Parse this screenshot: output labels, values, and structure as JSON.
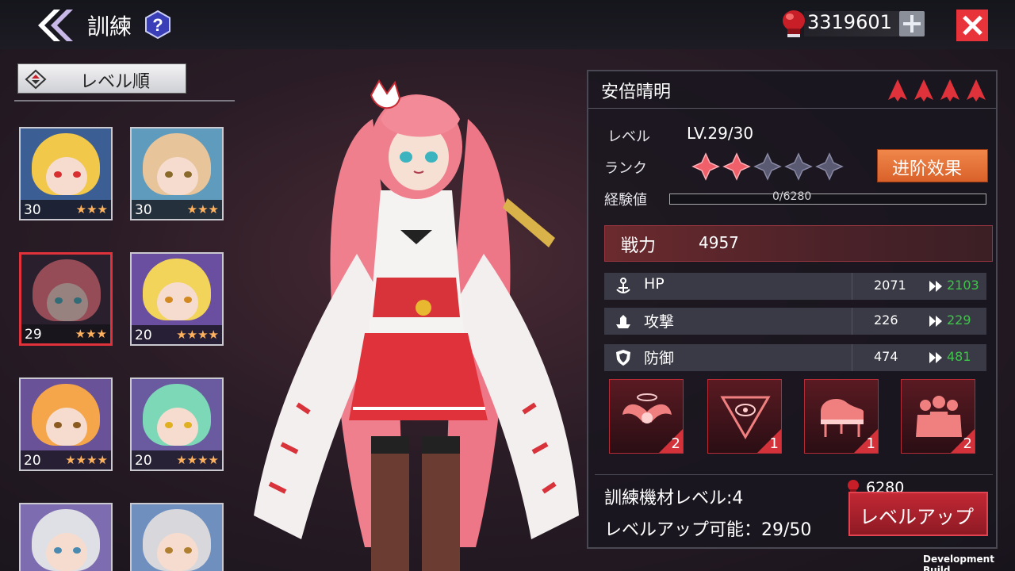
{
  "header": {
    "title": "訓練",
    "help_icon": "question-icon",
    "currency_value": "3319601",
    "currency_icon": "boxing-glove-icon",
    "add_icon": "plus-icon",
    "close_icon": "close-icon",
    "back_icon": "double-chevron-left-icon"
  },
  "sort": {
    "label": "レベル順"
  },
  "roster": [
    {
      "level": "30",
      "stars": "★★★",
      "hair": "#f2c84a",
      "eye": "#d83030",
      "bg": "#3b5f95"
    },
    {
      "level": "30",
      "stars": "★★★",
      "hair": "#e8c49a",
      "eye": "#8a6a2a",
      "bg": "#5f9bbd"
    },
    {
      "level": "29",
      "stars": "★★★",
      "hair": "#f07a86",
      "eye": "#3bb4c0",
      "bg": "#2c2a3a",
      "selected": true
    },
    {
      "level": "20",
      "stars": "★★★★",
      "hair": "#f2d45a",
      "eye": "#d28a20",
      "bg": "#6a4fa0"
    },
    {
      "level": "20",
      "stars": "★★★★",
      "hair": "#f5a64a",
      "eye": "#8a5a20",
      "bg": "#6a5298"
    },
    {
      "level": "20",
      "stars": "★★★★",
      "hair": "#7dd8b8",
      "eye": "#e0b020",
      "bg": "#6a5aa0"
    },
    {
      "level": "",
      "stars": "",
      "hair": "#dfe0e6",
      "eye": "#4a8ab0",
      "bg": "#7d6cb0"
    },
    {
      "level": "",
      "stars": "",
      "hair": "#d8d8dc",
      "eye": "#b08030",
      "bg": "#6f8fbf"
    }
  ],
  "panel": {
    "name": "安倍晴明",
    "level_label": "レベル",
    "level_value": "LV.29/30",
    "rank_label": "ランク",
    "rank_filled": 2,
    "rank_total": 5,
    "advance_button": "进阶效果",
    "exp_label": "経験値",
    "exp_text": "0/6280",
    "exp_progress": 0,
    "power_label": "戦力",
    "power_value": "4957",
    "stats": [
      {
        "label": "HP",
        "current": "2071",
        "next": "2103",
        "icon": "anchor-icon"
      },
      {
        "label": "攻撃",
        "current": "226",
        "next": "229",
        "icon": "ship-icon"
      },
      {
        "label": "防御",
        "current": "474",
        "next": "481",
        "icon": "shield-icon"
      }
    ],
    "skills": [
      {
        "icon": "winged-halo-icon",
        "count": "2"
      },
      {
        "icon": "eye-triangle-icon",
        "count": "1"
      },
      {
        "icon": "piano-icon",
        "count": "1"
      },
      {
        "icon": "crowd-silhouette-icon",
        "count": "2"
      }
    ],
    "equipment_level": "訓練機材レベル:4",
    "levelup_possible": "レベルアップ可能：29/50",
    "cost_value": "6280",
    "levelup_button": "レベルアップ"
  },
  "footer": {
    "dev_build": "Development Build"
  },
  "colors": {
    "accent_red": "#e0323a",
    "stat_green": "#3fc44a",
    "advance_orange": "#e8733a"
  }
}
